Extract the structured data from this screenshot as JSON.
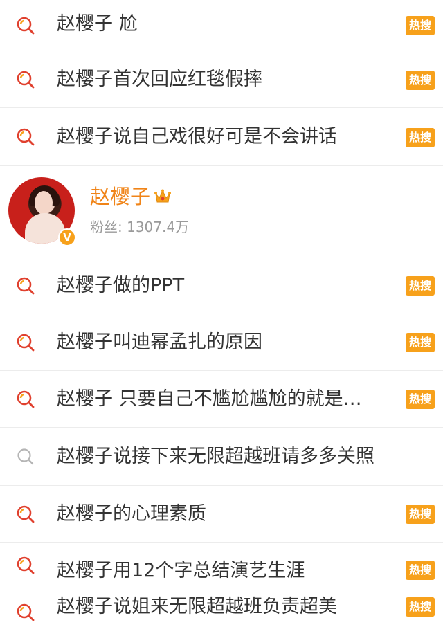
{
  "hot_label": "热搜",
  "search_items_top": [
    {
      "text": "赵樱子 尬",
      "hot": true
    },
    {
      "text": "赵樱子首次回应红毯假摔",
      "hot": true
    },
    {
      "text": "赵樱子说自己戏很好可是不会讲话",
      "hot": true
    }
  ],
  "user": {
    "name": "赵樱子",
    "fans_text": "粉丝: 1307.4万",
    "verified_mark": "V"
  },
  "search_items_bottom": [
    {
      "text": "赵樱子做的PPT",
      "hot": true
    },
    {
      "text": "赵樱子叫迪幂孟扎的原因",
      "hot": true
    },
    {
      "text": "赵樱子 只要自己不尴尬尴尬的就是…",
      "hot": true
    },
    {
      "text": "赵樱子说接下来无限超越班请多多关照",
      "hot": false
    },
    {
      "text": "赵樱子的心理素质",
      "hot": true
    },
    {
      "text": "赵樱子用12个字总结演艺生涯",
      "hot": true
    },
    {
      "text": "赵樱子说姐来无限超越班负责超美",
      "hot": true
    }
  ],
  "colors": {
    "accent_orange": "#f7a11b",
    "username_orange": "#f08418",
    "hot_icon_red": "#e0402e",
    "plain_icon_gray": "#b5b5b5"
  },
  "icons": {
    "hot_search": "hot-search-icon",
    "plain_search": "search-icon",
    "crown": "crown-icon"
  }
}
